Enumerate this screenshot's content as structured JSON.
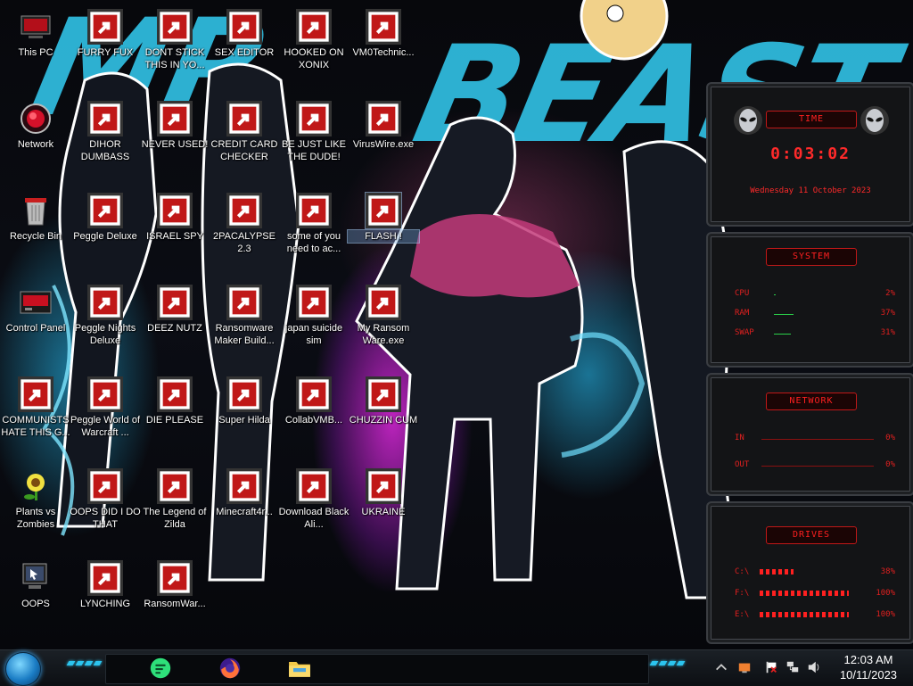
{
  "desktop": {
    "wallpaper_text": [
      "MR",
      "BEAST"
    ],
    "icons": [
      {
        "label": "This PC",
        "icon": "computer-icon"
      },
      {
        "label": "FURRY FUX",
        "icon": "firefox-icon"
      },
      {
        "label": "DONT STICK THIS IN YO...",
        "icon": "vlc-cone-icon"
      },
      {
        "label": "SEX EDITOR",
        "icon": "hex-editor-icon"
      },
      {
        "label": "HOOKED ON XONIX",
        "icon": "xonix-game-icon"
      },
      {
        "label": "VM0Technic...",
        "icon": "doctor-icon"
      },
      {
        "label": "Network",
        "icon": "network-orb-icon"
      },
      {
        "label": "DIHOR DUMBASS",
        "icon": "green-chat-icon"
      },
      {
        "label": "NEVER USED!",
        "icon": "dev-plus-icon"
      },
      {
        "label": "CREDIT CARD CHECKER",
        "icon": "credit-card-icon"
      },
      {
        "label": "BE JUST LIKE THE DUDE!",
        "icon": "santa-icon"
      },
      {
        "label": "VirusWire.exe",
        "icon": "lime-icon"
      },
      {
        "label": "Recycle Bin",
        "icon": "recycle-bin-icon"
      },
      {
        "label": "Peggle Deluxe",
        "icon": "peggle-icon"
      },
      {
        "label": "ISRAEL SPY",
        "icon": "spy-network-icon"
      },
      {
        "label": "2PACALYPSE 2.3",
        "icon": "terminal-icon"
      },
      {
        "label": "some of you need to ac...",
        "icon": "bear-icon"
      },
      {
        "label": "FLASH !",
        "icon": "flash-icon"
      },
      {
        "label": "Control Panel",
        "icon": "control-panel-icon"
      },
      {
        "label": "Peggle Nights Deluxe",
        "icon": "peggle-icon"
      },
      {
        "label": "DEEZ NUTZ",
        "icon": "windows-stack-icon"
      },
      {
        "label": "Ransomware Maker Build...",
        "icon": "app-window-icon"
      },
      {
        "label": "japan suicide sim",
        "icon": "document-icon"
      },
      {
        "label": "My Ransom Ware.exe",
        "icon": "app-window-icon"
      },
      {
        "label": "COMMUNISTS HATE THIS G...",
        "icon": "money-bag-icon"
      },
      {
        "label": "Peggle World of Warcraft ...",
        "icon": "peggle-icon"
      },
      {
        "label": "DIE PLEASE",
        "icon": "de-logo-icon"
      },
      {
        "label": "Super Hilda",
        "icon": "pixel-dog-icon"
      },
      {
        "label": "CollabVMB...",
        "icon": "monitor-icon"
      },
      {
        "label": "CHUZZIN CUM",
        "icon": "chuzzle-icon"
      },
      {
        "label": "Plants vs Zombies",
        "icon": "plant-icon"
      },
      {
        "label": "OOPS DID I DO THAT",
        "icon": "portrait-icon"
      },
      {
        "label": "The Legend of Zilda",
        "icon": "pixel-hero-icon"
      },
      {
        "label": "Minecraft4r...",
        "icon": "grass-block-icon"
      },
      {
        "label": "Download Black Ali...",
        "icon": "network-orb-icon"
      },
      {
        "label": "UKRAINE",
        "icon": "radiation-icon"
      },
      {
        "label": "OOPS",
        "icon": "monitor-cursor-icon"
      },
      {
        "label": "LYNCHING",
        "icon": "noose-icon"
      },
      {
        "label": "RansomWar...",
        "icon": "skull-icon"
      }
    ]
  },
  "gadget": {
    "time": {
      "header": "TIME",
      "clock": "0:03:02",
      "date": "Wednesday 11 October 2023"
    },
    "system": {
      "header": "SYSTEM",
      "rows": [
        {
          "label": "CPU",
          "value": "2%",
          "level": 0.02
        },
        {
          "label": "RAM",
          "value": "37%",
          "level": 0.37
        },
        {
          "label": "SWAP",
          "value": "31%",
          "level": 0.31
        }
      ]
    },
    "network": {
      "header": "NETWORK",
      "rows": [
        {
          "label": "IN",
          "value": "0%"
        },
        {
          "label": "OUT",
          "value": "0%"
        }
      ]
    },
    "drives": {
      "header": "DRIVES",
      "rows": [
        {
          "label": "C:\\",
          "value": "38%",
          "level": 0.38
        },
        {
          "label": "F:\\",
          "value": "100%",
          "level": 1.0
        },
        {
          "label": "E:\\",
          "value": "100%",
          "level": 1.0
        }
      ]
    }
  },
  "taskbar": {
    "pinned": [
      {
        "name": "taskbar-chat-app",
        "icon": "green-chat-icon"
      },
      {
        "name": "taskbar-firefox",
        "icon": "firefox-icon"
      },
      {
        "name": "taskbar-file-explorer",
        "icon": "folder-icon"
      }
    ],
    "tray": [
      "display-icon",
      "flag-icon",
      "network-icon",
      "volume-icon"
    ],
    "clock": {
      "time": "12:03 AM",
      "date": "10/11/2023"
    }
  },
  "colors": {
    "accent": "#2fb9dc",
    "gadget_red": "#ff2020",
    "taskbar": "#0c0f13"
  }
}
